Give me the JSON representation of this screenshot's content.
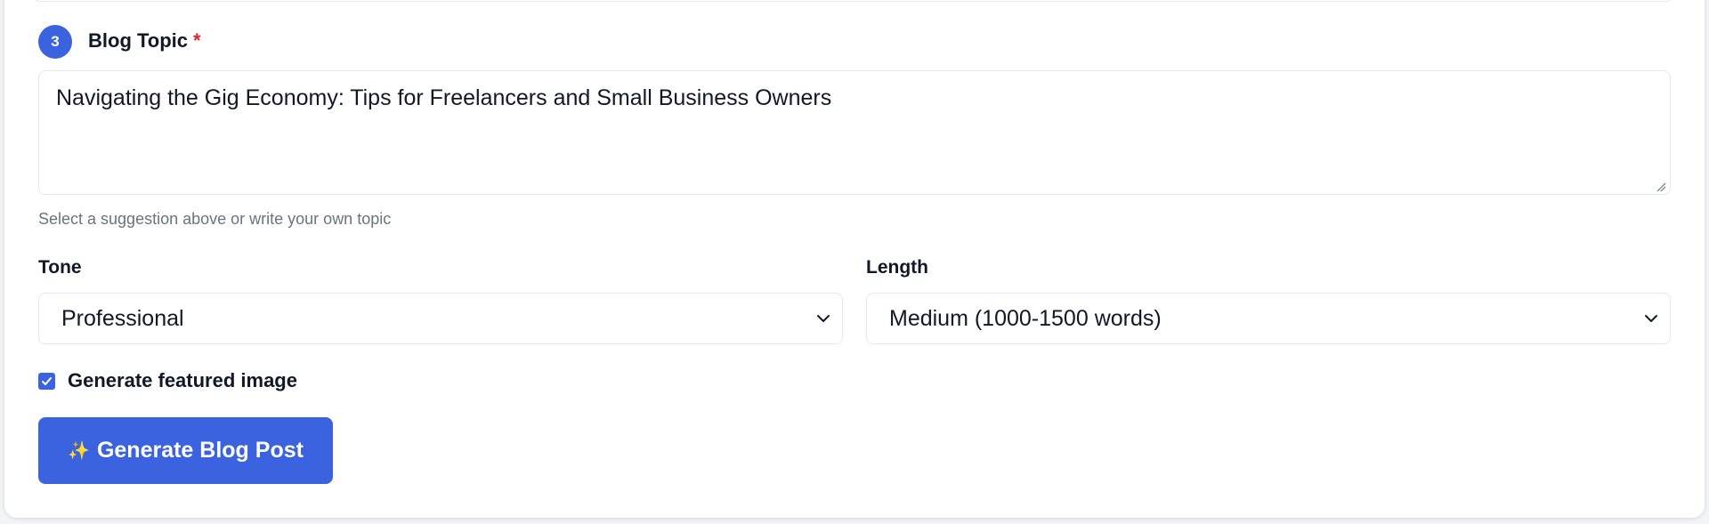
{
  "step": {
    "number": "3",
    "label": "Blog Topic",
    "required_marker": "*"
  },
  "topic": {
    "value": "Navigating the Gig Economy: Tips for Freelancers and Small Business Owners",
    "helper": "Select a suggestion above or write your own topic"
  },
  "tone": {
    "label": "Tone",
    "selected": "Professional"
  },
  "length": {
    "label": "Length",
    "selected": "Medium (1000-1500 words)"
  },
  "featured_image": {
    "label": "Generate featured image",
    "checked": true
  },
  "generate": {
    "icon": "sparkles-icon",
    "label": "Generate Blog Post"
  },
  "colors": {
    "accent": "#3b63e0",
    "required": "#dc2626",
    "helper_text": "#6b7280"
  }
}
